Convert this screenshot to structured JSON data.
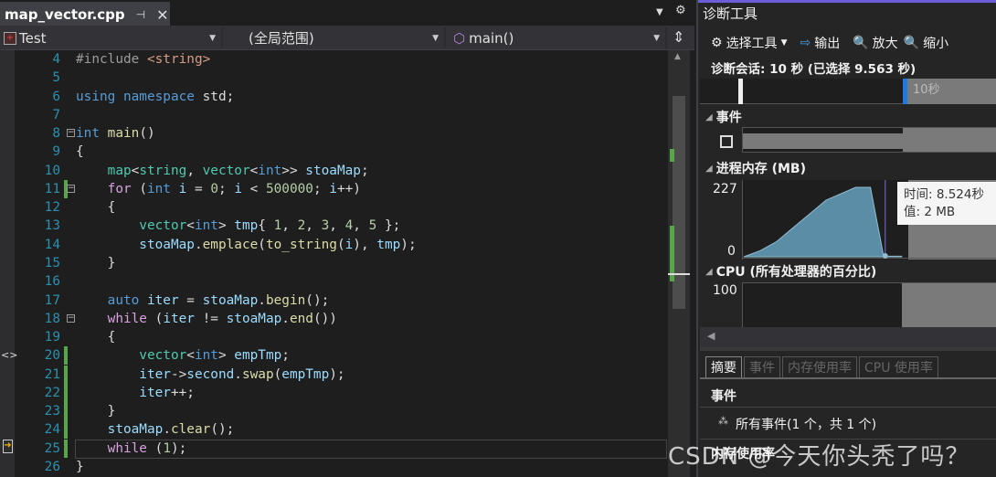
{
  "tab": {
    "filename": "map_vector.cpp",
    "pin_icon": "pin-icon",
    "close_icon": "close-icon"
  },
  "navbar": {
    "project": "Test",
    "scope": "(全局范围)",
    "member": "main()"
  },
  "code": [
    {
      "n": "4",
      "tokens": [
        [
          "#include ",
          "pp"
        ],
        [
          "<string>",
          "st"
        ]
      ]
    },
    {
      "n": "5",
      "tokens": []
    },
    {
      "n": "6",
      "tokens": [
        [
          "using namespace ",
          "kw"
        ],
        [
          "std",
          "pl"
        ],
        [
          ";",
          "pl"
        ]
      ]
    },
    {
      "n": "7",
      "tokens": []
    },
    {
      "n": "8",
      "fold": true,
      "tokens": [
        [
          "int ",
          "kw"
        ],
        [
          "main",
          "fn"
        ],
        [
          "()",
          "pl"
        ]
      ]
    },
    {
      "n": "9",
      "tokens": [
        [
          "{",
          "pl"
        ]
      ]
    },
    {
      "n": "10",
      "tokens": [
        [
          "    map",
          "ty"
        ],
        [
          "<",
          "pl"
        ],
        [
          "string",
          "ty"
        ],
        [
          ", ",
          "pl"
        ],
        [
          "vector",
          "ty"
        ],
        [
          "<",
          "pl"
        ],
        [
          "int",
          "kw"
        ],
        [
          ">> ",
          "pl"
        ],
        [
          "stoaMap",
          "va"
        ],
        [
          ";",
          "pl"
        ]
      ]
    },
    {
      "n": "11",
      "fold": true,
      "chg": true,
      "tokens": [
        [
          "    for ",
          "ct"
        ],
        [
          "(",
          "pl"
        ],
        [
          "int ",
          "kw"
        ],
        [
          "i",
          "va"
        ],
        [
          " = ",
          "pl"
        ],
        [
          "0",
          "nu"
        ],
        [
          "; ",
          "pl"
        ],
        [
          "i",
          "va"
        ],
        [
          " < ",
          "pl"
        ],
        [
          "500000",
          "nu"
        ],
        [
          "; ",
          "pl"
        ],
        [
          "i",
          "va"
        ],
        [
          "++)",
          "pl"
        ]
      ]
    },
    {
      "n": "12",
      "tokens": [
        [
          "    {",
          "pl"
        ]
      ]
    },
    {
      "n": "13",
      "tokens": [
        [
          "        vector",
          "ty"
        ],
        [
          "<",
          "pl"
        ],
        [
          "int",
          "kw"
        ],
        [
          "> ",
          "pl"
        ],
        [
          "tmp",
          "va"
        ],
        [
          "{ ",
          "pl"
        ],
        [
          "1",
          "nu"
        ],
        [
          ", ",
          "pl"
        ],
        [
          "2",
          "nu"
        ],
        [
          ", ",
          "pl"
        ],
        [
          "3",
          "nu"
        ],
        [
          ", ",
          "pl"
        ],
        [
          "4",
          "nu"
        ],
        [
          ", ",
          "pl"
        ],
        [
          "5",
          "nu"
        ],
        [
          " };",
          "pl"
        ]
      ]
    },
    {
      "n": "14",
      "tokens": [
        [
          "        stoaMap",
          "va"
        ],
        [
          ".",
          "pl"
        ],
        [
          "emplace",
          "fn"
        ],
        [
          "(",
          "pl"
        ],
        [
          "to_string",
          "fn"
        ],
        [
          "(",
          "pl"
        ],
        [
          "i",
          "va"
        ],
        [
          "), ",
          "pl"
        ],
        [
          "tmp",
          "va"
        ],
        [
          ");",
          "pl"
        ]
      ]
    },
    {
      "n": "15",
      "tokens": [
        [
          "    }",
          "pl"
        ]
      ]
    },
    {
      "n": "16",
      "tokens": []
    },
    {
      "n": "17",
      "tokens": [
        [
          "    auto ",
          "kw"
        ],
        [
          "iter",
          "va"
        ],
        [
          " = ",
          "pl"
        ],
        [
          "stoaMap",
          "va"
        ],
        [
          ".",
          "pl"
        ],
        [
          "begin",
          "fn"
        ],
        [
          "();",
          "pl"
        ]
      ]
    },
    {
      "n": "18",
      "fold": true,
      "tokens": [
        [
          "    while ",
          "ct"
        ],
        [
          "(",
          "pl"
        ],
        [
          "iter",
          "va"
        ],
        [
          " != ",
          "pl"
        ],
        [
          "stoaMap",
          "va"
        ],
        [
          ".",
          "pl"
        ],
        [
          "end",
          "fn"
        ],
        [
          "())",
          "pl"
        ]
      ]
    },
    {
      "n": "19",
      "tokens": [
        [
          "    {",
          "pl"
        ]
      ]
    },
    {
      "n": "20",
      "chg": true,
      "tokens": [
        [
          "        vector",
          "ty"
        ],
        [
          "<",
          "pl"
        ],
        [
          "int",
          "kw"
        ],
        [
          "> ",
          "pl"
        ],
        [
          "empTmp",
          "va"
        ],
        [
          ";",
          "pl"
        ]
      ]
    },
    {
      "n": "21",
      "chg": true,
      "tokens": [
        [
          "        iter",
          "va"
        ],
        [
          "->",
          "pl"
        ],
        [
          "second",
          "va"
        ],
        [
          ".",
          "pl"
        ],
        [
          "swap",
          "fn"
        ],
        [
          "(",
          "pl"
        ],
        [
          "empTmp",
          "va"
        ],
        [
          ");",
          "pl"
        ]
      ]
    },
    {
      "n": "22",
      "chg": true,
      "tokens": [
        [
          "        iter",
          "va"
        ],
        [
          "++;",
          "pl"
        ]
      ]
    },
    {
      "n": "23",
      "chg": true,
      "tokens": [
        [
          "    }",
          "pl"
        ]
      ]
    },
    {
      "n": "24",
      "chg": true,
      "tokens": [
        [
          "    stoaMap",
          "va"
        ],
        [
          ".",
          "pl"
        ],
        [
          "clear",
          "fn"
        ],
        [
          "();",
          "pl"
        ]
      ]
    },
    {
      "n": "25",
      "chg": true,
      "current": true,
      "tokens": [
        [
          "    while ",
          "ct"
        ],
        [
          "(",
          "pl"
        ],
        [
          "1",
          "nu"
        ],
        [
          ");",
          "pl"
        ]
      ]
    },
    {
      "n": "26",
      "tokens": [
        [
          "}",
          "pl"
        ]
      ]
    }
  ],
  "diag": {
    "title": "诊断工具",
    "toolbar": {
      "select_tools": "选择工具",
      "output": "输出",
      "zoom_in": "放大",
      "zoom_out": "缩小"
    },
    "session": "诊断会话: 10 秒 (已选择 9.563 秒)",
    "timeline_label": "10秒",
    "events_header": "事件",
    "memory_header": "进程内存 (MB)",
    "memory_ymax": "227",
    "memory_ymin": "0",
    "tooltip_time": "时间: 8.524秒",
    "tooltip_value": "值: 2 MB",
    "cpu_header": "CPU (所有处理器的百分比)",
    "cpu_ymax": "100",
    "tabs": [
      "摘要",
      "事件",
      "内存使用率",
      "CPU 使用率"
    ],
    "summary_events": "事件",
    "all_events": "所有事件(1 个，共 1 个)",
    "memory_usage": "内存使用率"
  },
  "chart_data": {
    "type": "area",
    "x": [
      0,
      1,
      2,
      3,
      4,
      5,
      6.8,
      7.7,
      8.5,
      9.6
    ],
    "values": [
      0,
      20,
      50,
      95,
      140,
      185,
      227,
      227,
      2,
      2
    ],
    "ylim": [
      0,
      227
    ],
    "color": "#5b8ea6",
    "selection_start": 10
  },
  "watermark": "CSDN @今天你头秃了吗？"
}
